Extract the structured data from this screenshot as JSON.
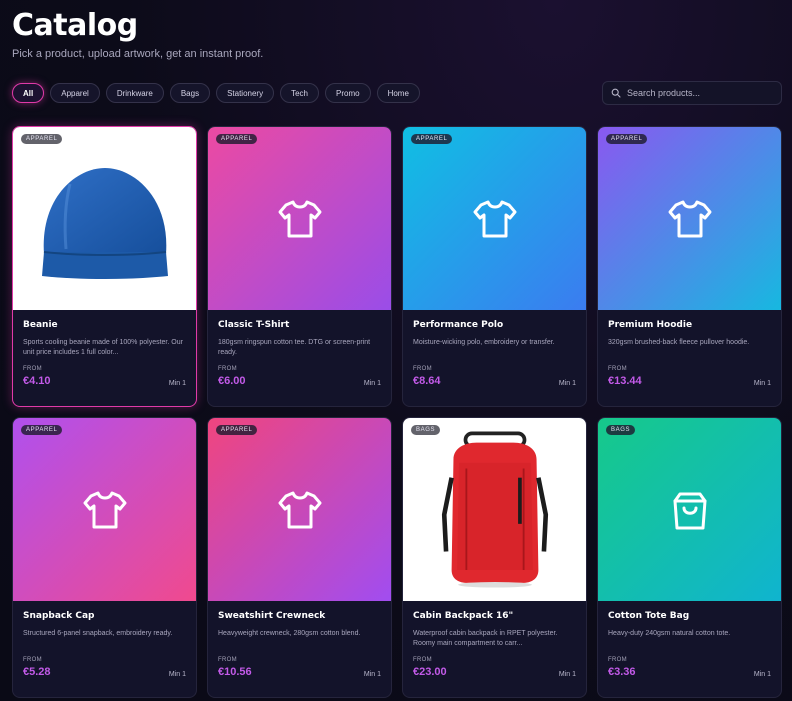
{
  "header": {
    "title": "Catalog",
    "subtitle": "Pick a product, upload artwork, get an instant proof."
  },
  "filters": [
    "All",
    "Apparel",
    "Drinkware",
    "Bags",
    "Stationery",
    "Tech",
    "Promo",
    "Home"
  ],
  "active_filter": "All",
  "search": {
    "placeholder": "Search products..."
  },
  "colors": {
    "accent": "#e03aa8",
    "price": "#c25ae8"
  },
  "products": [
    {
      "category": "APPAREL",
      "name": "Beanie",
      "desc": "Sports cooling beanie made of 100% polyester. Our unit price includes 1 full color...",
      "from": "FROM",
      "price": "€4.10",
      "min": "Min 1",
      "image": "beanie-photo",
      "selected": true
    },
    {
      "category": "APPAREL",
      "name": "Classic T-Shirt",
      "desc": "180gsm ringspun cotton tee. DTG or screen-print ready.",
      "from": "FROM",
      "price": "€6.00",
      "min": "Min 1",
      "image": "tshirt-icon",
      "gradient": "g-pink"
    },
    {
      "category": "APPAREL",
      "name": "Performance Polo",
      "desc": "Moisture-wicking polo, embroidery or transfer.",
      "from": "FROM",
      "price": "€8.64",
      "min": "Min 1",
      "image": "tshirt-icon",
      "gradient": "g-cyan"
    },
    {
      "category": "APPAREL",
      "name": "Premium Hoodie",
      "desc": "320gsm brushed-back fleece pullover hoodie.",
      "from": "FROM",
      "price": "€13.44",
      "min": "Min 1",
      "image": "tshirt-icon",
      "gradient": "g-violet"
    },
    {
      "category": "APPAREL",
      "name": "Snapback Cap",
      "desc": "Structured 6-panel snapback, embroidery ready.",
      "from": "FROM",
      "price": "€5.28",
      "min": "Min 1",
      "image": "tshirt-icon",
      "gradient": "g-magenta"
    },
    {
      "category": "APPAREL",
      "name": "Sweatshirt Crewneck",
      "desc": "Heavyweight crewneck, 280gsm cotton blend.",
      "from": "FROM",
      "price": "€10.56",
      "min": "Min 1",
      "image": "tshirt-icon",
      "gradient": "g-rose"
    },
    {
      "category": "BAGS",
      "name": "Cabin Backpack 16\"",
      "desc": "Waterproof cabin backpack in RPET polyester. Roomy main compartment to carr...",
      "from": "FROM",
      "price": "€23.00",
      "min": "Min 1",
      "image": "backpack-photo"
    },
    {
      "category": "BAGS",
      "name": "Cotton Tote Bag",
      "desc": "Heavy-duty 240gsm natural cotton tote.",
      "from": "FROM",
      "price": "€3.36",
      "min": "Min 1",
      "image": "bag-icon",
      "gradient": "g-teal"
    }
  ]
}
